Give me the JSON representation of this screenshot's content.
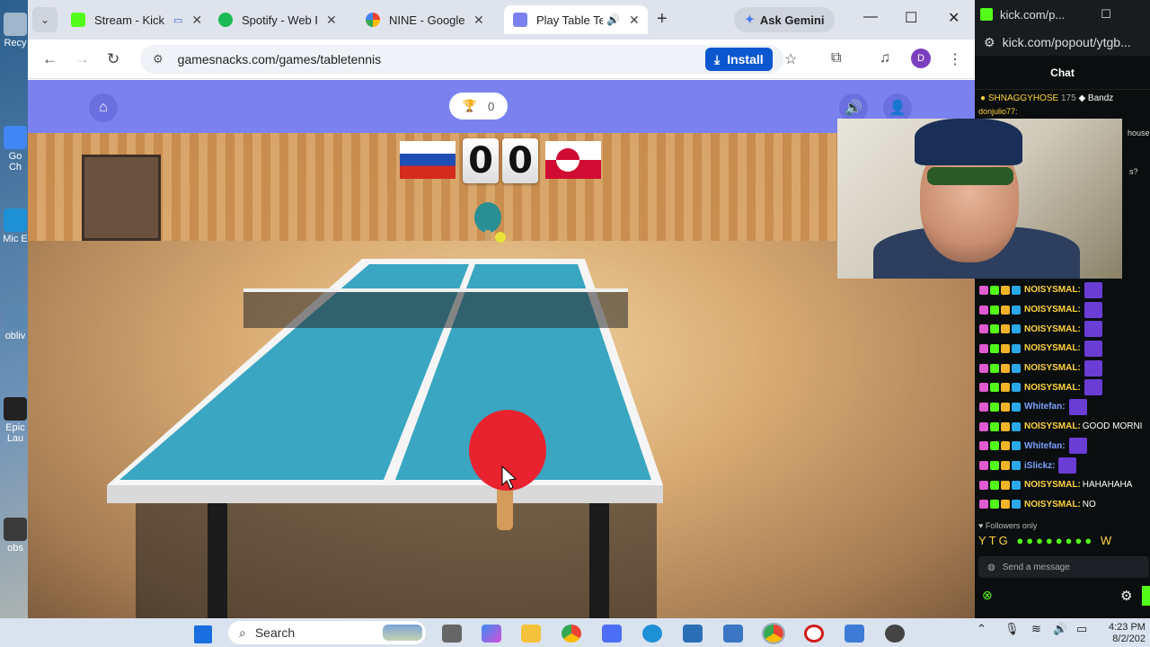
{
  "browser": {
    "tabs": [
      {
        "label": "Stream - Kick",
        "favicon_color": "#53fc18",
        "active": false
      },
      {
        "label": "Spotify - Web Pl",
        "favicon_color": "#1db954",
        "active": false
      },
      {
        "label": "NINE - Google S",
        "favicon_color": "#4285f4",
        "active": false
      },
      {
        "label": "Play Table Te",
        "favicon_color": "#7b82f0",
        "active": true
      }
    ],
    "new_tab": "+",
    "ask_gemini": "Ask Gemini",
    "url": "gamesnacks.com/games/tabletennis",
    "install_label": "Install",
    "profile_initial": "D"
  },
  "game": {
    "trophy_count": "0",
    "score_left": "0",
    "score_right": "0",
    "flag_left": "Russia",
    "flag_right": "Greenland",
    "header_color": "#7b82f0",
    "table_color": "#3aa6c1",
    "paddle_color": "#e8232f"
  },
  "chat": {
    "window_title": "kick.com/p...",
    "url": "kick.com/popout/ytgb...",
    "heading": "Chat",
    "pinned_user": "SHNAGGYHOSE",
    "pinned_count": "175",
    "pinned_user2": "Bandz",
    "partial_user": "donjulio77:",
    "partial_1": "house",
    "partial_2": "s?",
    "messages": [
      {
        "user": "NOISYSMAL:",
        "text": "",
        "color": "#ffd33d",
        "emote": true
      },
      {
        "user": "NOISYSMAL:",
        "text": "",
        "color": "#ffd33d",
        "emote": true
      },
      {
        "user": "NOISYSMAL:",
        "text": "",
        "color": "#ffd33d",
        "emote": true
      },
      {
        "user": "NOISYSMAL:",
        "text": "",
        "color": "#ffd33d",
        "emote": true
      },
      {
        "user": "NOISYSMAL:",
        "text": "",
        "color": "#ffd33d",
        "emote": true
      },
      {
        "user": "NOISYSMAL:",
        "text": "",
        "color": "#ffd33d",
        "emote": true
      },
      {
        "user": "Whitefan:",
        "text": "",
        "color": "#7da2ff",
        "emote": true
      },
      {
        "user": "NOISYSMAL:",
        "text": "GOOD MORNI",
        "color": "#ffd33d",
        "emote": false
      },
      {
        "user": "Whitefan:",
        "text": "",
        "color": "#7da2ff",
        "emote": true
      },
      {
        "user": "iSlickz:",
        "text": "",
        "color": "#7da2ff",
        "emote": true
      },
      {
        "user": "NOISYSMAL:",
        "text": "HAHAHAHA",
        "color": "#ffd33d",
        "emote": false
      },
      {
        "user": "NOISYSMAL:",
        "text": "NO",
        "color": "#ffd33d",
        "emote": false
      }
    ],
    "followers_only": "Followers only",
    "emote_row": "YTG",
    "emote_row_end": "W",
    "send_placeholder": "Send a message"
  },
  "desktop": {
    "icons": [
      "Recy",
      "Go Ch",
      "Mic E",
      "obliv",
      "Epic Lau",
      "obs"
    ]
  },
  "taskbar": {
    "search_label": "Search",
    "time": "4:23 PM",
    "date": "8/2/202"
  }
}
